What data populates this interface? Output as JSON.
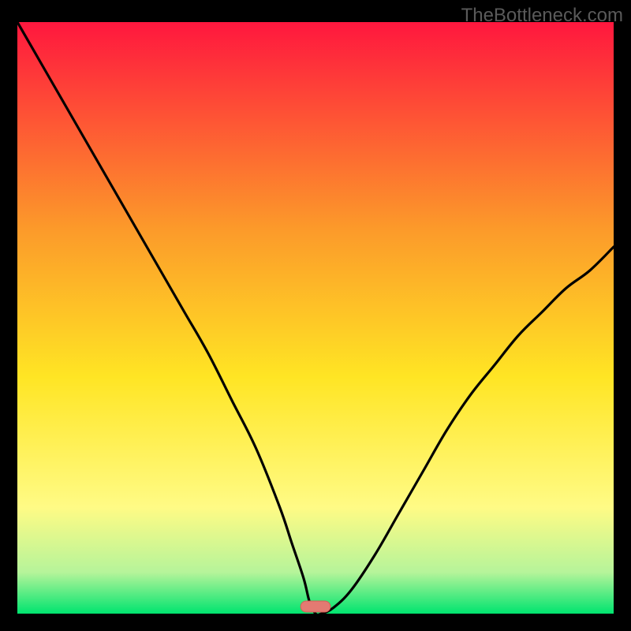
{
  "attribution": "TheBottleneck.com",
  "colors": {
    "bg": "#000000",
    "gradient_top": "#ff173e",
    "gradient_upper_mid": "#fc9a2a",
    "gradient_mid": "#ffe524",
    "gradient_lower_mid": "#fffb85",
    "gradient_near_bottom": "#b6f49a",
    "gradient_bottom": "#00e46f",
    "curve": "#000000",
    "marker_fill": "#e37a72",
    "marker_stroke": "#d35f56"
  },
  "chart_data": {
    "type": "line",
    "title": "",
    "xlabel": "",
    "ylabel": "",
    "xlim": [
      0,
      100
    ],
    "ylim": [
      0,
      100
    ],
    "series": [
      {
        "name": "bottleneck-curve",
        "x": [
          0,
          4,
          8,
          12,
          16,
          20,
          24,
          28,
          32,
          36,
          40,
          44,
          46,
          48,
          49,
          50,
          51,
          53,
          56,
          60,
          64,
          68,
          72,
          76,
          80,
          84,
          88,
          92,
          96,
          100
        ],
        "values": [
          100,
          93,
          86,
          79,
          72,
          65,
          58,
          51,
          44,
          36,
          28,
          18,
          12,
          6,
          2,
          0,
          0,
          1,
          4,
          10,
          17,
          24,
          31,
          37,
          42,
          47,
          51,
          55,
          58,
          62
        ]
      }
    ],
    "marker": {
      "x": 50,
      "y": 0,
      "w": 5,
      "h": 2
    },
    "annotations": []
  }
}
